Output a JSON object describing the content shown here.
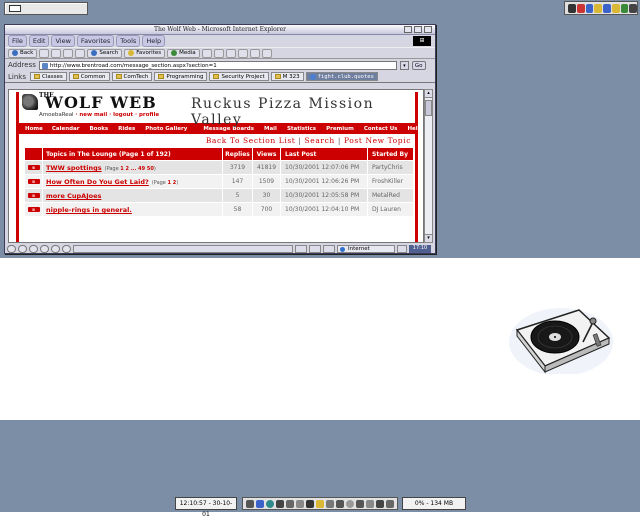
{
  "window": {
    "title": "The Wolf Web - Microsoft Internet Explorer"
  },
  "menu": [
    "File",
    "Edit",
    "View",
    "Favorites",
    "Tools",
    "Help"
  ],
  "toolbar": {
    "back": "Back",
    "search": "Search",
    "favorites": "Favorites",
    "media": "Media"
  },
  "address": {
    "label": "Address",
    "url": "http://www.brentroad.com/message_section.aspx?section=1",
    "go": "Go"
  },
  "links": {
    "label": "Links",
    "items": [
      "Classes",
      "Common",
      "ComTech",
      "Programming",
      "Security Project",
      "M 323",
      "fight.club.quotes"
    ]
  },
  "site": {
    "name_small": "THE",
    "name": "WOLF WEB",
    "user": "AmoebaReal",
    "user_links": "· new mail · logout · profile",
    "ad": "Ruckus Pizza Mission Valley",
    "nav": [
      "Home",
      "Calendar",
      "Books",
      "Rides",
      "Photo Gallery",
      "Message Boards",
      "Mail",
      "Statistics",
      "Premium",
      "Contact Us",
      "Help"
    ],
    "crumbs": [
      "Back To Section List",
      "Search",
      "Post New Topic"
    ]
  },
  "table": {
    "headers": [
      "Topics in The Lounge (Page 1 of 192)",
      "Replies",
      "Views",
      "Last Post",
      "Started By"
    ],
    "rows": [
      {
        "topic": "TWW spottings",
        "pages_prefix": "(Page",
        "pages_list": "1 2 ... 49 50",
        "pages_suffix": ")",
        "replies": "3719",
        "views": "41819",
        "last_post": "10/30/2001 12:07:06 PM",
        "started_by": "PartyChris"
      },
      {
        "topic": "How Often Do You Get Laid?",
        "pages_prefix": "(Page",
        "pages_list": "1 2",
        "pages_suffix": ")",
        "replies": "147",
        "views": "1509",
        "last_post": "10/30/2001 12:06:26 PM",
        "started_by": "FroshKiller"
      },
      {
        "topic": "more CupAJoes",
        "pages_prefix": "",
        "pages_list": "",
        "pages_suffix": "",
        "replies": "5",
        "views": "30",
        "last_post": "10/30/2001 12:05:58 PM",
        "started_by": "MetalRed"
      },
      {
        "topic": "nipple-rings in general.",
        "pages_prefix": "",
        "pages_list": "",
        "pages_suffix": "",
        "replies": "58",
        "views": "700",
        "last_post": "10/30/2001 12:04:10 PM",
        "started_by": "DJ Lauren"
      }
    ]
  },
  "status": {
    "zone": "Internet",
    "time": "17:10"
  },
  "taskbar": {
    "clock": "12:10:57 - 30-10-01",
    "memory": "0% - 134 MB"
  },
  "colors": {
    "accent": "#cc0000",
    "desktop": "#7b8ea5",
    "chrome": "#d6d6e2"
  }
}
